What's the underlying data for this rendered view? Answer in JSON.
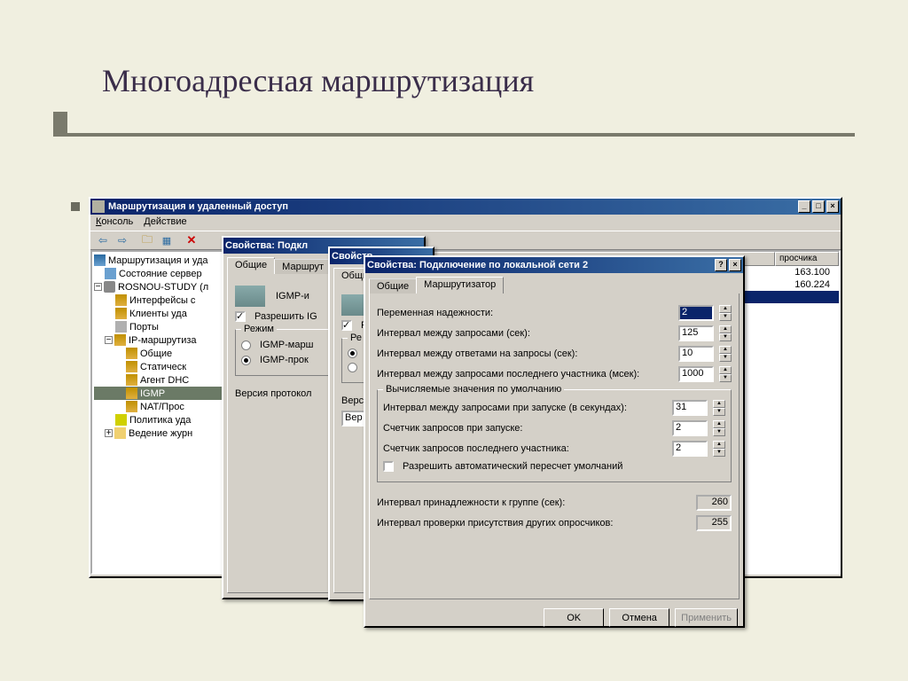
{
  "slide": {
    "title": "Многоадресная маршрутизация"
  },
  "mmc": {
    "title": "Маршрутизация и удаленный доступ",
    "menu": {
      "console": "Консоль",
      "action": "Действие"
    },
    "tree": {
      "root": "Маршрутизация и уда",
      "srvstate": "Состояние сервер",
      "host": "ROSNOU-STUDY (л",
      "ifaces": "Интерфейсы с",
      "clients": "Клиенты уда",
      "ports": "Порты",
      "iproute": "IP-маршрутиза",
      "general": "Общие",
      "static": "Статическ",
      "dhcp": "Агент DHC",
      "igmp": "IGMP",
      "nat": "NAT/Прос",
      "policy": "Политика уда",
      "logging": "Ведение журн"
    },
    "listhdr": {
      "c1": "просчика"
    },
    "listrows": {
      "r1": "163.100",
      "r2": "160.224"
    }
  },
  "dlg1": {
    "title": "Свойства: Подкл",
    "tabs": {
      "general": "Общие",
      "router": "Маршрут"
    },
    "igmp_label": "IGMP-и",
    "allow": "Разрешить IG",
    "mode": "Режим",
    "opt_router": "IGMP-марш",
    "opt_proxy": "IGMP-прок",
    "version": "Версия протокол"
  },
  "dlg2": {
    "title": "Свойств",
    "tabs": {
      "general": "Общи"
    },
    "allow": "Р",
    "mode": "Ре",
    "version": "Верс",
    "dd": "Вер"
  },
  "dlg3": {
    "title": "Свойства: Подключение по локальной сети 2",
    "tabs": {
      "general": "Общие",
      "router": "Маршрутизатор"
    },
    "fields": {
      "reliability": "Переменная надежности:",
      "query_interval": "Интервал между запросами (сек):",
      "response_interval": "Интервал между ответами на запросы (сек):",
      "last_member_interval": "Интервал между запросами последнего участника (мсек):"
    },
    "values": {
      "reliability": "2",
      "query_interval": "125",
      "response_interval": "10",
      "last_member_interval": "1000"
    },
    "group_defaults": "Вычисляемые значения по умолчанию",
    "defaults": {
      "startup_query": "Интервал между запросами при запуске (в секундах):",
      "startup_count": "Счетчик запросов при запуске:",
      "last_member_count": "Счетчик запросов последнего участника:",
      "auto": "Разрешить автоматический пересчет умолчаний"
    },
    "defaults_values": {
      "startup_query": "31",
      "startup_count": "2",
      "last_member_count": "2"
    },
    "readonly": {
      "membership": "Интервал принадлежности к группе (сек):",
      "presence": "Интервал проверки присутствия других опросчиков:"
    },
    "readonly_values": {
      "membership": "260",
      "presence": "255"
    },
    "buttons": {
      "ok": "OK",
      "cancel": "Отмена",
      "apply": "Применить"
    }
  }
}
